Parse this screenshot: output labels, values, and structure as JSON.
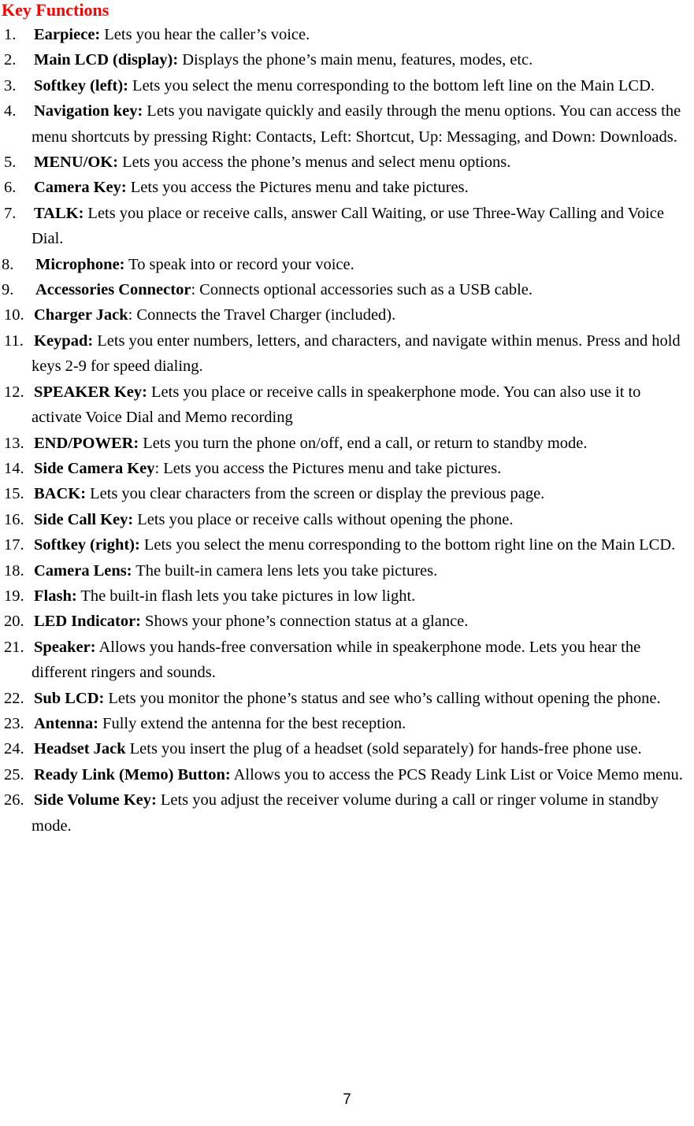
{
  "document": {
    "title": "Key Functions",
    "title_color": "#ff0000",
    "page_number": "7"
  },
  "items": [
    {
      "number": "1.",
      "term": "Earpiece:",
      "desc": " Lets you hear the caller’s voice."
    },
    {
      "number": "2.",
      "term": "Main LCD (display):",
      "desc": " Displays the phone’s main menu, features, modes, etc."
    },
    {
      "number": "3.",
      "term": "Softkey (left):",
      "desc": " Lets you select the menu corresponding to the bottom left line on the Main LCD."
    },
    {
      "number": "4.",
      "term": "Navigation key:",
      "desc": " Lets you navigate quickly and easily through the menu options. You can access the menu shortcuts by pressing Right: Contacts, Left: Shortcut, Up: Messaging, and Down: Downloads."
    },
    {
      "number": "5.",
      "term": "MENU/OK:",
      "desc": " Lets you access the phone’s menus and select menu options."
    },
    {
      "number": "6.",
      "term": "Camera Key:",
      "desc": " Lets you access the Pictures menu and take pictures."
    },
    {
      "number": "7.",
      "term": "TALK:",
      "desc": " Lets you place or receive calls, answer Call Waiting, or use Three-Way Calling and Voice Dial."
    },
    {
      "number": "8.",
      "term": "Microphone:",
      "desc": " To speak into or record your voice."
    },
    {
      "number": "9.",
      "term": "Accessories Connector",
      "desc": ": Connects optional accessories such as a USB cable."
    },
    {
      "number": "10.",
      "term": "Charger Jack",
      "desc": ": Connects the Travel Charger (included)."
    },
    {
      "number": "11.",
      "term": "Keypad:",
      "desc": " Lets you enter numbers, letters, and characters, and navigate within menus. Press and hold keys 2-9 for speed dialing."
    },
    {
      "number": "12.",
      "term": "SPEAKER Key:",
      "desc": " Lets you place or receive calls in speakerphone mode. You can also use it to activate Voice Dial and Memo recording"
    },
    {
      "number": "13.",
      "term": "END/POWER:",
      "desc": " Lets you turn the phone on/off, end a call, or return to standby mode."
    },
    {
      "number": "14.",
      "term": "Side Camera Key",
      "desc": ": Lets you access the Pictures menu and take pictures."
    },
    {
      "number": "15.",
      "term": "BACK:",
      "desc": " Lets you clear characters from the screen or display the previous page."
    },
    {
      "number": "16.",
      "term": "Side Call Key:",
      "desc": " Lets you place or receive calls without opening the phone."
    },
    {
      "number": "17.",
      "term": "Softkey (right):",
      "desc": " Lets you select the menu corresponding to the bottom right line on the Main LCD."
    },
    {
      "number": "18.",
      "term": "Camera Lens:",
      "desc": " The built-in camera lens lets you take pictures."
    },
    {
      "number": "19.",
      "term": "Flash:",
      "desc": " The built-in flash lets you take pictures in low light."
    },
    {
      "number": "20.",
      "term": "LED Indicator:",
      "desc": " Shows your phone’s connection status at a glance."
    },
    {
      "number": "21.",
      "term": "Speaker:",
      "desc": " Allows you hands-free conversation while in speakerphone mode. Lets you hear the different ringers and sounds."
    },
    {
      "number": "22.",
      "term": "Sub LCD:",
      "desc": " Lets you monitor the phone’s status and see who’s calling without opening the phone."
    },
    {
      "number": "23.",
      "term": "Antenna:",
      "desc": " Fully extend the antenna for the best reception."
    },
    {
      "number": "24.",
      "term": "Headset Jack",
      "desc": " Lets you insert the plug of a headset (sold separately) for hands-free phone use."
    },
    {
      "number": "25.",
      "term": "Ready Link (Memo) Button:",
      "desc": " Allows you to access the PCS Ready Link List or Voice Memo menu."
    },
    {
      "number": "26.",
      "term": "Side Volume Key:",
      "desc": " Lets you adjust the receiver volume during a call or ringer volume in standby mode."
    }
  ]
}
